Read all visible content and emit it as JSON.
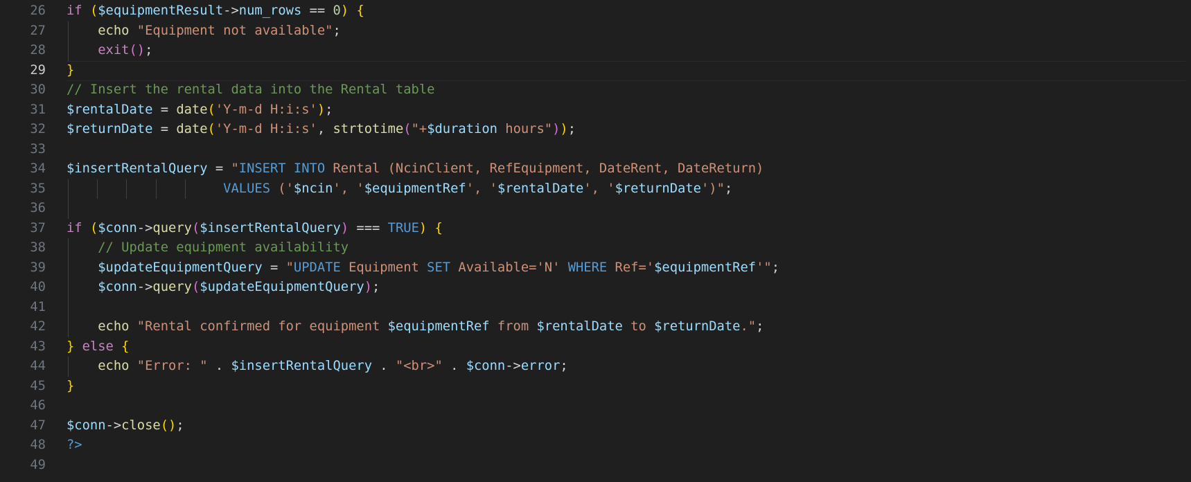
{
  "editor": {
    "first_line": 26,
    "active_line": 29,
    "lines": [
      {
        "n": "26",
        "tokens": [
          [
            "kw",
            "if"
          ],
          [
            "plain",
            " "
          ],
          [
            "b1",
            "("
          ],
          [
            "var",
            "$equipmentResult"
          ],
          [
            "op",
            "->"
          ],
          [
            "var",
            "num_rows"
          ],
          [
            "op",
            " == "
          ],
          [
            "num",
            "0"
          ],
          [
            "b1",
            ")"
          ],
          [
            "plain",
            " "
          ],
          [
            "b1",
            "{"
          ]
        ],
        "guides": []
      },
      {
        "n": "27",
        "tokens": [
          [
            "plain",
            "    "
          ],
          [
            "fn",
            "echo"
          ],
          [
            "plain",
            " "
          ],
          [
            "str",
            "\"Equipment not available\""
          ],
          [
            "plain",
            ";"
          ]
        ],
        "guides": [
          0
        ]
      },
      {
        "n": "28",
        "tokens": [
          [
            "plain",
            "    "
          ],
          [
            "kw",
            "exit"
          ],
          [
            "b2",
            "()"
          ],
          [
            "plain",
            ";"
          ]
        ],
        "guides": [
          0
        ]
      },
      {
        "n": "29",
        "tokens": [
          [
            "b1",
            "}"
          ]
        ],
        "guides": []
      },
      {
        "n": "30",
        "tokens": [
          [
            "cm",
            "// Insert the rental data into the Rental table"
          ]
        ],
        "guides": []
      },
      {
        "n": "31",
        "tokens": [
          [
            "var",
            "$rentalDate"
          ],
          [
            "op",
            " = "
          ],
          [
            "fn",
            "date"
          ],
          [
            "b1",
            "("
          ],
          [
            "str",
            "'Y-m-d H:i:s'"
          ],
          [
            "b1",
            ")"
          ],
          [
            "plain",
            ";"
          ]
        ],
        "guides": []
      },
      {
        "n": "32",
        "tokens": [
          [
            "var",
            "$returnDate"
          ],
          [
            "op",
            " = "
          ],
          [
            "fn",
            "date"
          ],
          [
            "b1",
            "("
          ],
          [
            "str",
            "'Y-m-d H:i:s'"
          ],
          [
            "plain",
            ", "
          ],
          [
            "fn",
            "strtotime"
          ],
          [
            "b2",
            "("
          ],
          [
            "str",
            "\"+"
          ],
          [
            "var",
            "$duration"
          ],
          [
            "str",
            " hours\""
          ],
          [
            "b2",
            ")"
          ],
          [
            "b1",
            ")"
          ],
          [
            "plain",
            ";"
          ]
        ],
        "guides": []
      },
      {
        "n": "33",
        "tokens": [],
        "guides": []
      },
      {
        "n": "34",
        "tokens": [
          [
            "var",
            "$insertRentalQuery"
          ],
          [
            "op",
            " = "
          ],
          [
            "str",
            "\""
          ],
          [
            "sqlkw",
            "INSERT INTO"
          ],
          [
            "str",
            " Rental (NcinClient, RefEquipment, DateRent, DateReturn)"
          ]
        ],
        "guides": []
      },
      {
        "n": "35",
        "tokens": [
          [
            "plain",
            "                    "
          ],
          [
            "sqlkw",
            "VALUES"
          ],
          [
            "str",
            " ('"
          ],
          [
            "var",
            "$ncin"
          ],
          [
            "str",
            "', '"
          ],
          [
            "var",
            "$equipmentRef"
          ],
          [
            "str",
            "', '"
          ],
          [
            "var",
            "$rentalDate"
          ],
          [
            "str",
            "', '"
          ],
          [
            "var",
            "$returnDate"
          ],
          [
            "str",
            "')\""
          ],
          [
            "plain",
            ";"
          ]
        ],
        "guides": [
          0,
          1,
          2,
          3,
          4
        ]
      },
      {
        "n": "36",
        "tokens": [],
        "guides": [
          0
        ]
      },
      {
        "n": "37",
        "tokens": [
          [
            "kw",
            "if"
          ],
          [
            "plain",
            " "
          ],
          [
            "b1",
            "("
          ],
          [
            "var",
            "$conn"
          ],
          [
            "op",
            "->"
          ],
          [
            "fn",
            "query"
          ],
          [
            "b2",
            "("
          ],
          [
            "var",
            "$insertRentalQuery"
          ],
          [
            "b2",
            ")"
          ],
          [
            "op",
            " === "
          ],
          [
            "const",
            "TRUE"
          ],
          [
            "b1",
            ")"
          ],
          [
            "plain",
            " "
          ],
          [
            "b1",
            "{"
          ]
        ],
        "guides": []
      },
      {
        "n": "38",
        "tokens": [
          [
            "plain",
            "    "
          ],
          [
            "cm",
            "// Update equipment availability"
          ]
        ],
        "guides": [
          0
        ]
      },
      {
        "n": "39",
        "tokens": [
          [
            "plain",
            "    "
          ],
          [
            "var",
            "$updateEquipmentQuery"
          ],
          [
            "op",
            " = "
          ],
          [
            "str",
            "\""
          ],
          [
            "sqlkw",
            "UPDATE"
          ],
          [
            "str",
            " Equipment "
          ],
          [
            "sqlkw",
            "SET"
          ],
          [
            "str",
            " Available='N' "
          ],
          [
            "sqlkw",
            "WHERE"
          ],
          [
            "str",
            " Ref='"
          ],
          [
            "var",
            "$equipmentRef"
          ],
          [
            "str",
            "'\""
          ],
          [
            "plain",
            ";"
          ]
        ],
        "guides": [
          0
        ]
      },
      {
        "n": "40",
        "tokens": [
          [
            "plain",
            "    "
          ],
          [
            "var",
            "$conn"
          ],
          [
            "op",
            "->"
          ],
          [
            "fn",
            "query"
          ],
          [
            "b2",
            "("
          ],
          [
            "var",
            "$updateEquipmentQuery"
          ],
          [
            "b2",
            ")"
          ],
          [
            "plain",
            ";"
          ]
        ],
        "guides": [
          0
        ]
      },
      {
        "n": "41",
        "tokens": [],
        "guides": [
          0
        ]
      },
      {
        "n": "42",
        "tokens": [
          [
            "plain",
            "    "
          ],
          [
            "fn",
            "echo"
          ],
          [
            "plain",
            " "
          ],
          [
            "str",
            "\"Rental confirmed for equipment "
          ],
          [
            "var",
            "$equipmentRef"
          ],
          [
            "str",
            " from "
          ],
          [
            "var",
            "$rentalDate"
          ],
          [
            "str",
            " to "
          ],
          [
            "var",
            "$returnDate"
          ],
          [
            "str",
            ".\""
          ],
          [
            "plain",
            ";"
          ]
        ],
        "guides": [
          0
        ]
      },
      {
        "n": "43",
        "tokens": [
          [
            "b1",
            "}"
          ],
          [
            "plain",
            " "
          ],
          [
            "kw",
            "else"
          ],
          [
            "plain",
            " "
          ],
          [
            "b1",
            "{"
          ]
        ],
        "guides": []
      },
      {
        "n": "44",
        "tokens": [
          [
            "plain",
            "    "
          ],
          [
            "fn",
            "echo"
          ],
          [
            "plain",
            " "
          ],
          [
            "str",
            "\"Error: \""
          ],
          [
            "op",
            " . "
          ],
          [
            "var",
            "$insertRentalQuery"
          ],
          [
            "op",
            " . "
          ],
          [
            "str",
            "\"<br>\""
          ],
          [
            "op",
            " . "
          ],
          [
            "var",
            "$conn"
          ],
          [
            "op",
            "->"
          ],
          [
            "var",
            "error"
          ],
          [
            "plain",
            ";"
          ]
        ],
        "guides": [
          0
        ]
      },
      {
        "n": "45",
        "tokens": [
          [
            "b1",
            "}"
          ]
        ],
        "guides": []
      },
      {
        "n": "46",
        "tokens": [],
        "guides": []
      },
      {
        "n": "47",
        "tokens": [
          [
            "var",
            "$conn"
          ],
          [
            "op",
            "->"
          ],
          [
            "fn",
            "close"
          ],
          [
            "b1",
            "()"
          ],
          [
            "plain",
            ";"
          ]
        ],
        "guides": []
      },
      {
        "n": "48",
        "tokens": [
          [
            "const",
            "?>"
          ]
        ],
        "guides": []
      },
      {
        "n": "49",
        "tokens": [],
        "guides": []
      }
    ]
  }
}
